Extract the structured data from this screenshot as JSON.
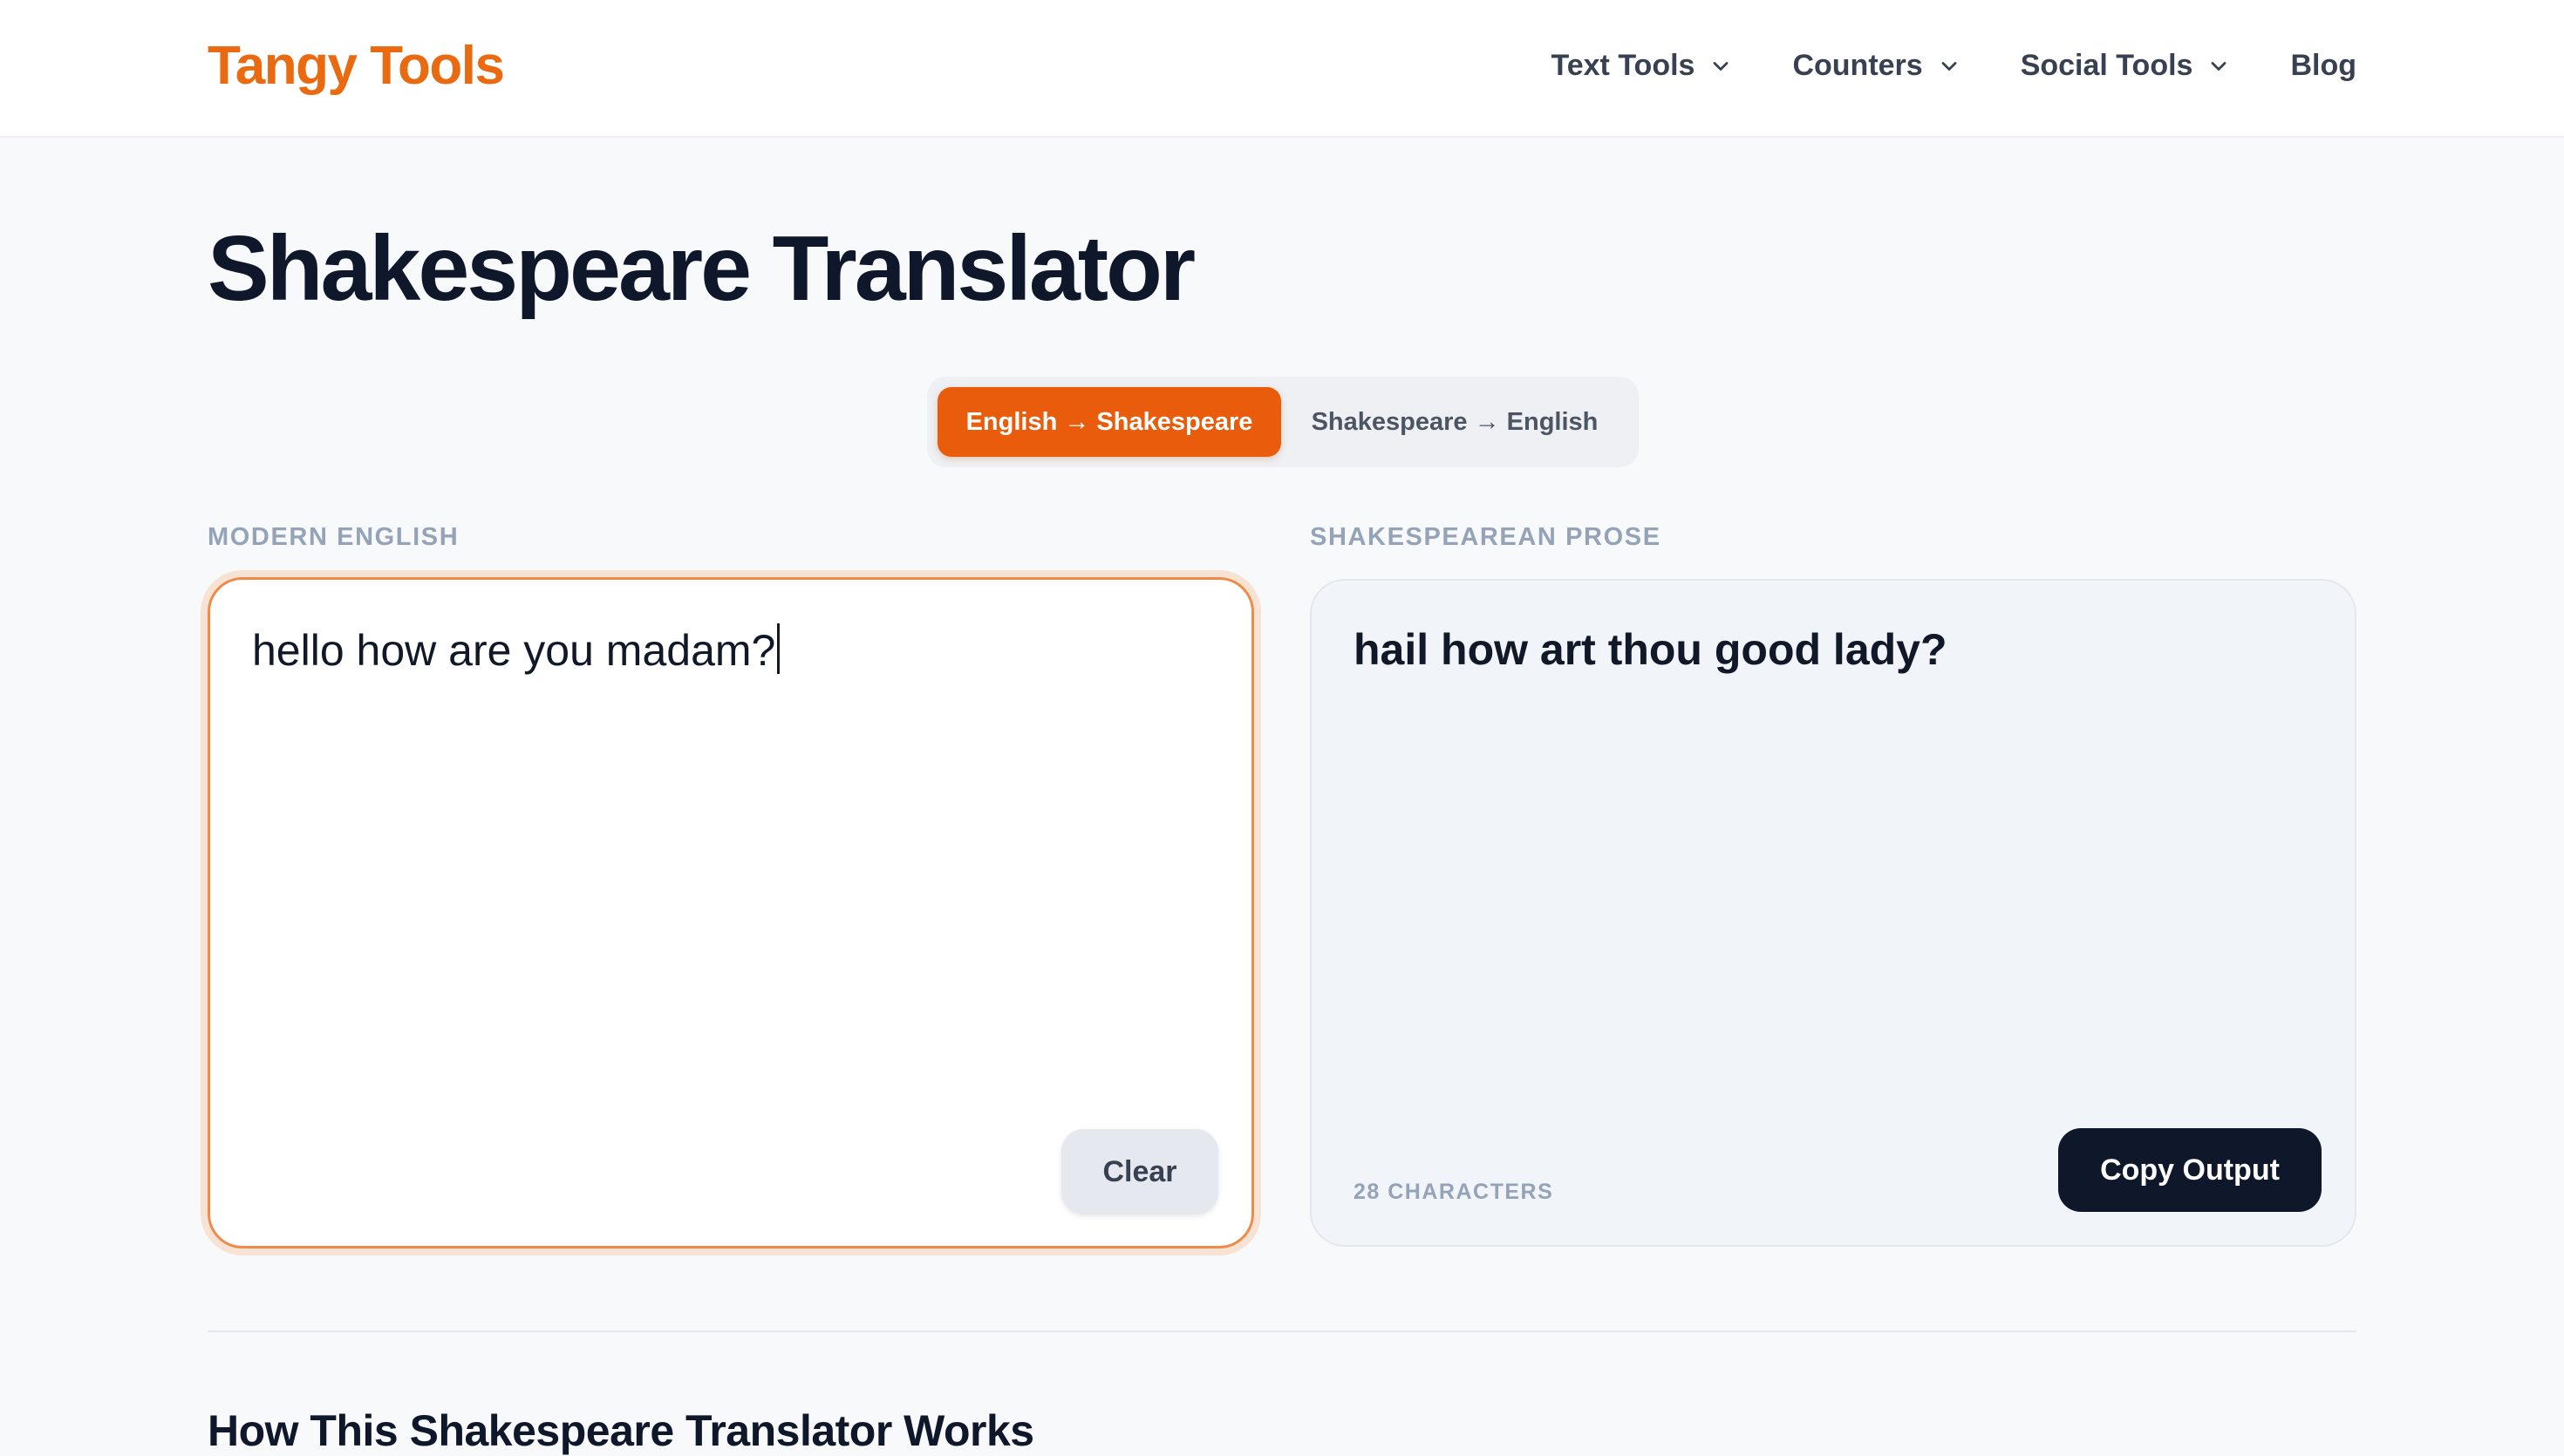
{
  "header": {
    "logo": "Tangy Tools",
    "nav": [
      {
        "label": "Text Tools",
        "has_dropdown": true
      },
      {
        "label": "Counters",
        "has_dropdown": true
      },
      {
        "label": "Social Tools",
        "has_dropdown": true
      },
      {
        "label": "Blog",
        "has_dropdown": false
      }
    ]
  },
  "page": {
    "title": "Shakespeare Translator"
  },
  "mode_toggle": {
    "options": [
      {
        "label": "English → Shakespeare",
        "selected": true
      },
      {
        "label": "Shakespeare → English",
        "selected": false
      }
    ]
  },
  "input_panel": {
    "label": "MODERN ENGLISH",
    "value": "hello how are you madam?",
    "clear_label": "Clear"
  },
  "output_panel": {
    "label": "SHAKESPEAREAN PROSE",
    "value": "hail how art thou good lady?",
    "char_count": "28 CHARACTERS",
    "copy_label": "Copy Output"
  },
  "section": {
    "heading": "How This Shakespeare Translator Works"
  },
  "colors": {
    "brand": "#ea6a12",
    "active_toggle": "#e85c0c",
    "dark_button": "#0f172a",
    "input_border": "#f08a4b"
  }
}
